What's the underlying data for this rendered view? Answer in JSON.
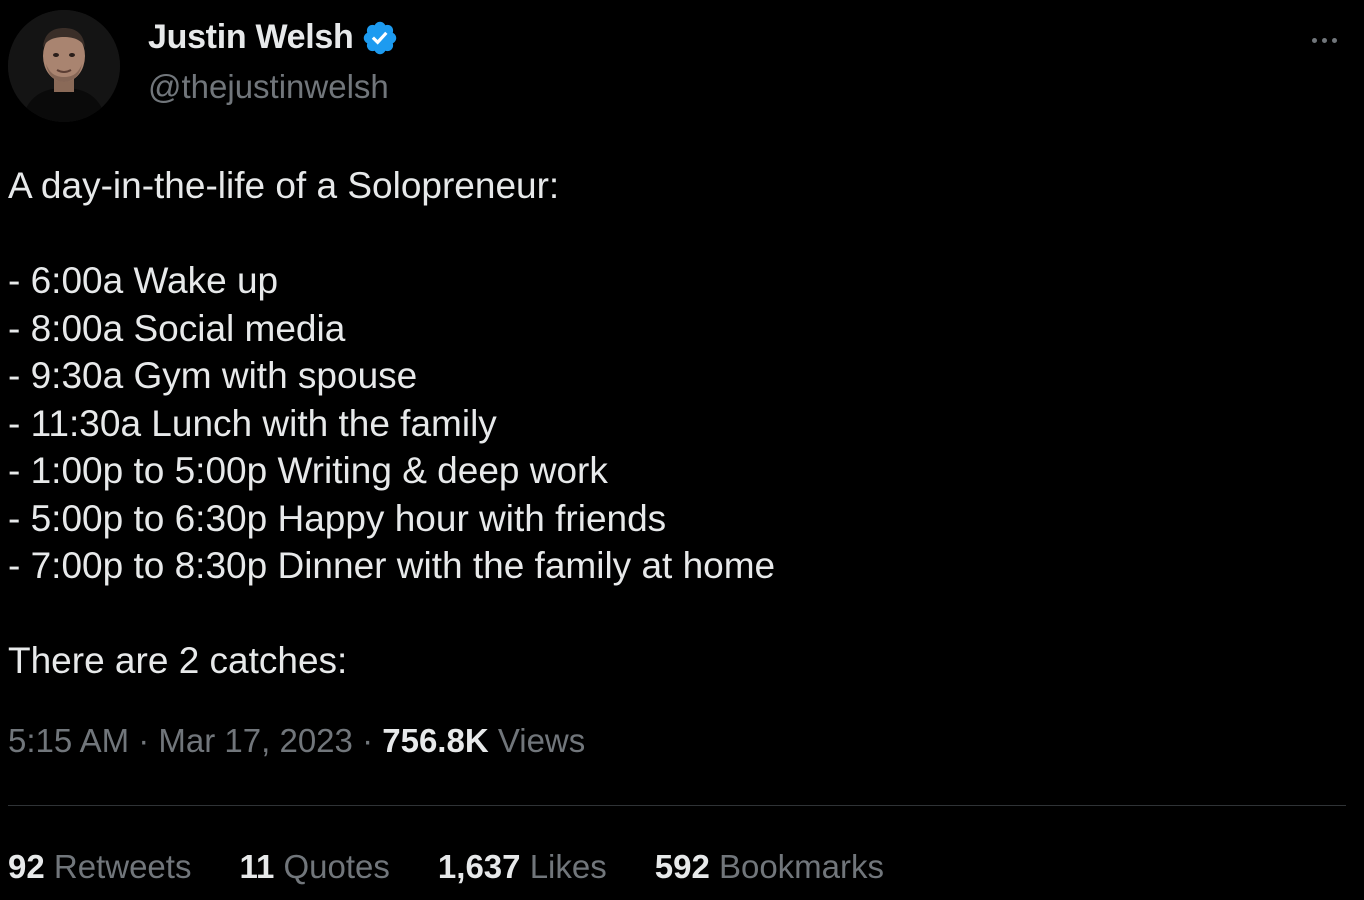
{
  "author": {
    "display_name": "Justin Welsh",
    "handle": "@thejustinwelsh",
    "verified": true,
    "verified_color": "#1d9bf0"
  },
  "tweet": {
    "lines": [
      "A day-in-the-life of a Solopreneur:",
      "",
      "- 6:00a Wake up",
      "- 8:00a Social media",
      "- 9:30a Gym with spouse",
      "- 11:30a Lunch with the family",
      "- 1:00p to 5:00p Writing & deep work",
      "- 5:00p to 6:30p Happy hour with friends",
      "- 7:00p to 8:30p Dinner with the family at home",
      "",
      "There are 2 catches:"
    ]
  },
  "meta": {
    "time": "5:15 AM",
    "separator": "·",
    "date": "Mar 17, 2023",
    "views_count": "756.8K",
    "views_label": "Views"
  },
  "stats": [
    {
      "count": "92",
      "label": "Retweets"
    },
    {
      "count": "11",
      "label": "Quotes"
    },
    {
      "count": "1,637",
      "label": "Likes"
    },
    {
      "count": "592",
      "label": "Bookmarks"
    }
  ],
  "icons": {
    "more": "more-horizontal-icon",
    "verified": "verified-badge-icon"
  },
  "colors": {
    "background": "#000000",
    "text": "#e7e9ea",
    "secondary": "#71767b",
    "divider": "#2f3336"
  }
}
